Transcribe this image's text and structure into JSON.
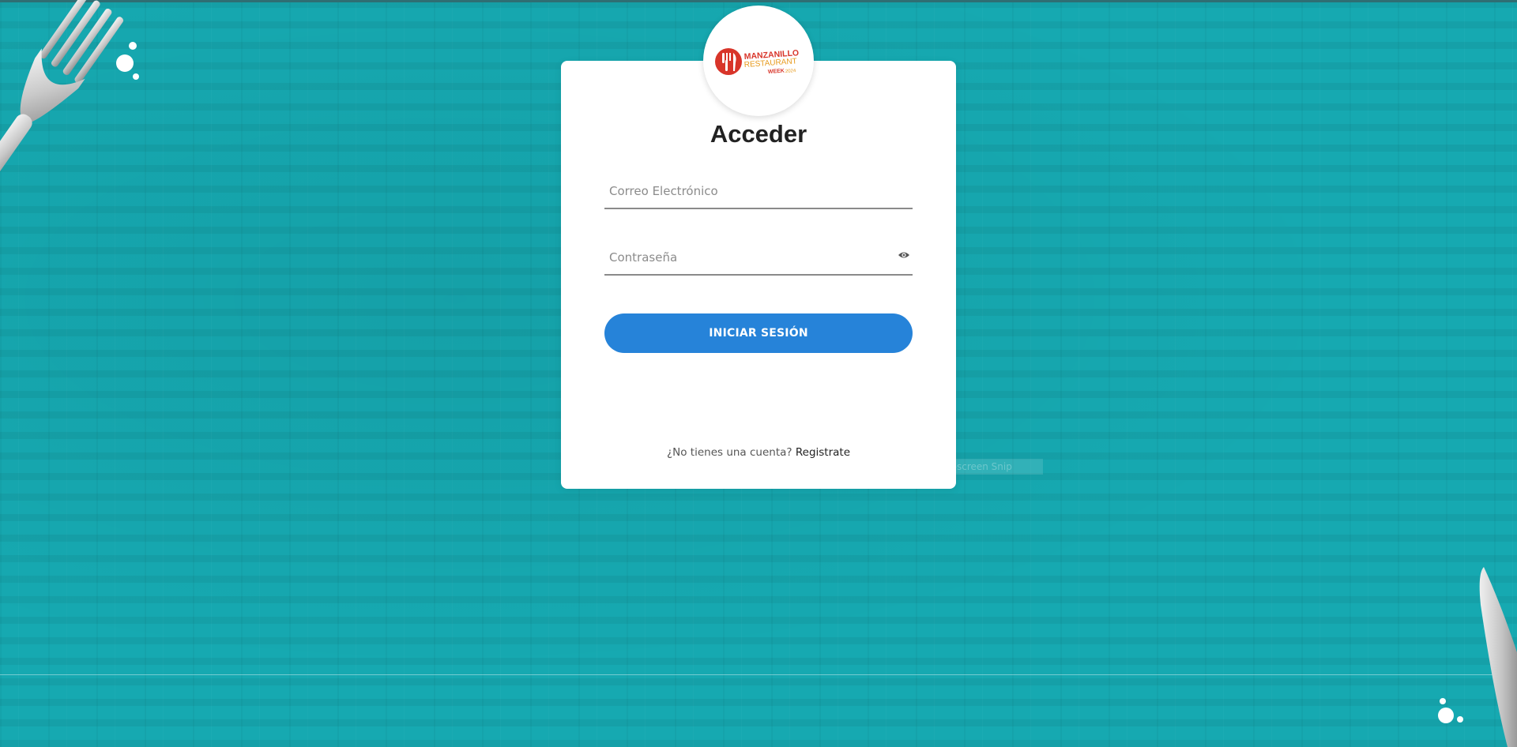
{
  "logo": {
    "line1": "MANZANILLO",
    "line2": "RESTAURANT",
    "line3": "WEEK",
    "year": "2024",
    "colors": {
      "red": "#d8352a",
      "orange": "#e79a1c"
    }
  },
  "login": {
    "title": "Acceder",
    "email_placeholder": "Correo Electrónico",
    "password_placeholder": "Contraseña",
    "submit_label": "INICIAR SESIÓN",
    "signup_prompt": "¿No tienes una cuenta?",
    "signup_link": "Registrate"
  },
  "overlay": {
    "snip_label": "Full-screen Snip"
  },
  "colors": {
    "background": "#16a9b1",
    "button": "#2683d9",
    "card": "#ffffff"
  },
  "icons": {
    "password_toggle": "eye-icon",
    "fork": "fork-icon",
    "knife": "knife-icon"
  }
}
